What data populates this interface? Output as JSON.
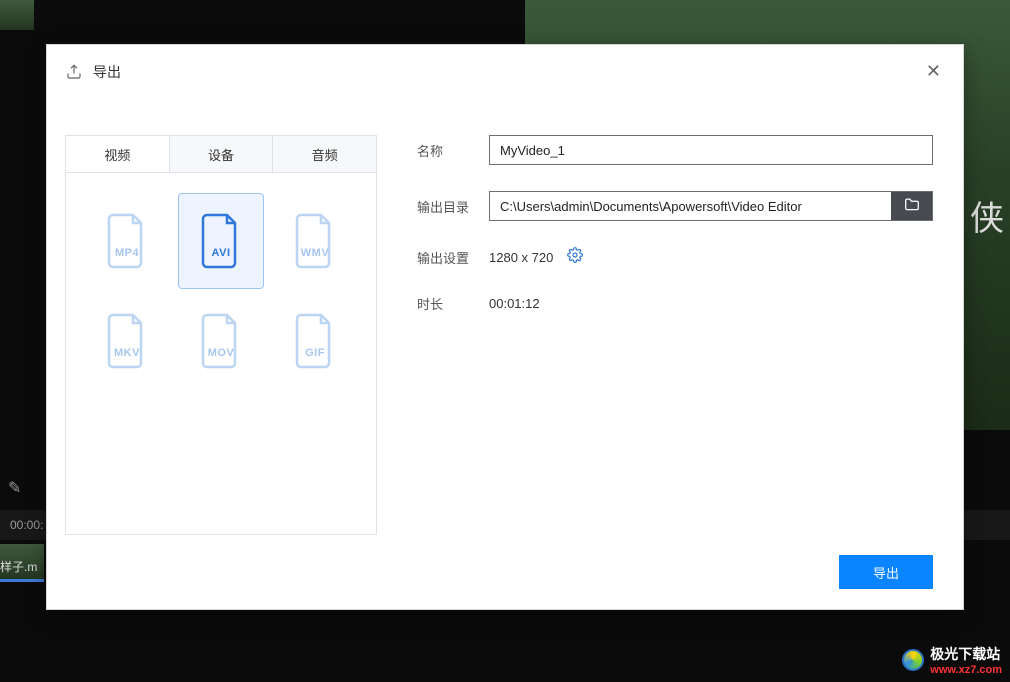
{
  "modal": {
    "title": "导出",
    "close": "✕",
    "tabs": {
      "video": "视频",
      "device": "设备",
      "audio": "音频"
    },
    "formats": [
      {
        "id": "mp4",
        "label": "MP4",
        "selected": false
      },
      {
        "id": "avi",
        "label": "AVI",
        "selected": true
      },
      {
        "id": "wmv",
        "label": "WMV",
        "selected": false
      },
      {
        "id": "mkv",
        "label": "MKV",
        "selected": false
      },
      {
        "id": "mov",
        "label": "MOV",
        "selected": false
      },
      {
        "id": "gif",
        "label": "GIF",
        "selected": false
      }
    ],
    "form": {
      "name_label": "名称",
      "name_value": "MyVideo_1",
      "output_dir_label": "输出目录",
      "output_dir_value": "C:\\Users\\admin\\Documents\\Apowersoft\\Video Editor",
      "output_settings_label": "输出设置",
      "output_settings_value": "1280 x 720",
      "duration_label": "时长",
      "duration_value": "00:01:12"
    },
    "export_button": "导出"
  },
  "background": {
    "preview_overlay_text": "侠",
    "timeline_time": "00:00:",
    "clip_name": "样子.m",
    "pencil_icon": "✎"
  },
  "branding": {
    "title": "极光下载站",
    "url": "www.xz7.com"
  }
}
